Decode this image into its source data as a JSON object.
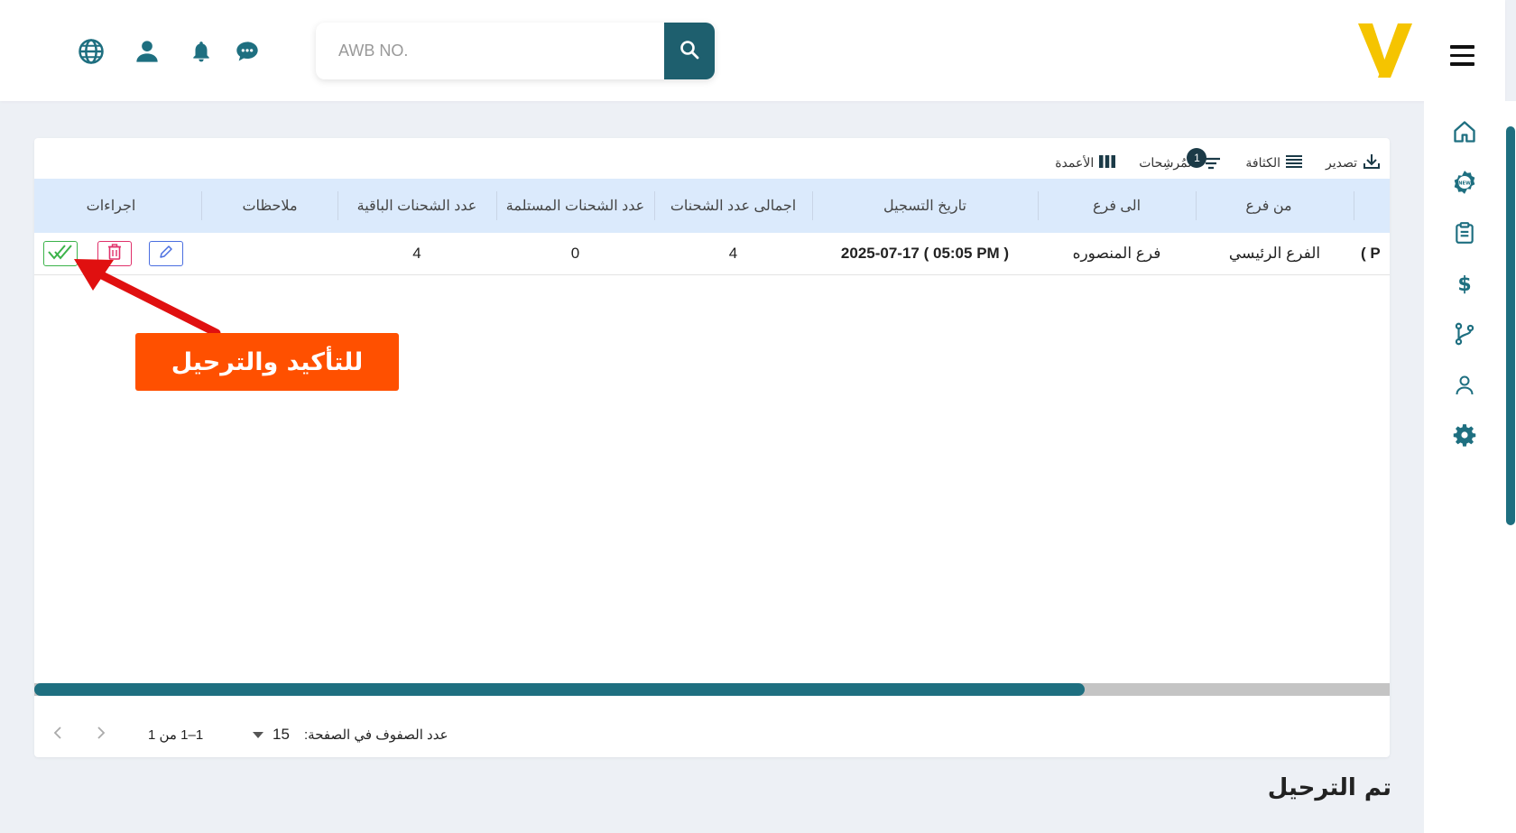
{
  "header": {
    "search": {
      "placeholder": "AWB NO.",
      "value": ""
    },
    "icons": [
      "globe-icon",
      "user-icon",
      "bell-icon",
      "chat-icon",
      "search-icon"
    ]
  },
  "sidebar": {
    "items": [
      "home-icon",
      "new-badge-icon",
      "clipboard-icon",
      "dollar-icon",
      "branches-icon",
      "person-icon",
      "settings-icon"
    ]
  },
  "toolbar": {
    "columns_label": "الأعمدة",
    "filters_label": "المُرشِحات",
    "filters_count": "1",
    "density_label": "الكثافة",
    "export_label": "تصدير"
  },
  "table": {
    "headers": {
      "from_branch": "من فرع",
      "to_branch": "الى فرع",
      "reg_date": "تاريخ التسجيل",
      "total_shipments": "اجمالى عدد الشحنات",
      "received_shipments": "عدد الشحنات المستلمة",
      "remaining_shipments": "عدد الشحنات الباقية",
      "notes": "ملاحظات",
      "actions": "اجراءات"
    },
    "rows": [
      {
        "clipped": "( P",
        "from_branch": "الفرع الرئيسي",
        "to_branch": "فرع المنصوره",
        "reg_date": "2025-07-17 ( 05:05 PM )",
        "total_shipments": "4",
        "received_shipments": "0",
        "remaining_shipments": "4",
        "notes": ""
      }
    ]
  },
  "pagination": {
    "rows_per_page_label": "عدد الصفوف في الصفحة:",
    "rows_per_page": "15",
    "range": "1–1 من 1"
  },
  "callout": {
    "text": "للتأكيد والترحيل"
  },
  "section_title": "تم الترحيل",
  "colors": {
    "accent": "#1e5f6e",
    "icon_teal": "#1e6f80",
    "logo_yellow": "#f5c400",
    "header_row": "#dbeafc",
    "callout": "#ff5000",
    "arrow": "#e01010",
    "confirm_green": "#3bb34a",
    "delete_red": "#e0306a",
    "edit_blue": "#4a6ee0"
  }
}
